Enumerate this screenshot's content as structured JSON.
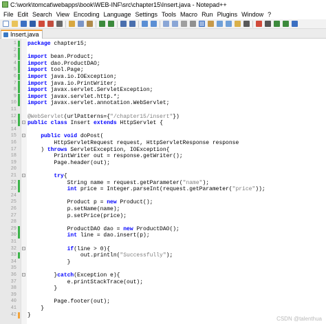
{
  "window": {
    "title": "C:\\work\\tomcat\\webapps\\book\\WEB-INF\\src\\chapter15\\Insert.java - Notepad++"
  },
  "menu": [
    "File",
    "Edit",
    "Search",
    "View",
    "Encoding",
    "Language",
    "Settings",
    "Tools",
    "Macro",
    "Run",
    "Plugins",
    "Window",
    "?"
  ],
  "tab": {
    "label": "Insert.java"
  },
  "colors": {
    "keyword": "#0000ff",
    "string": "#808080",
    "comment": "#008000",
    "change_saved": "#3cb34a",
    "change_unsaved": "#f2a33a"
  },
  "editor": {
    "lines": [
      {
        "n": "1",
        "text": "package chapter15;",
        "mark": "green"
      },
      {
        "n": "2",
        "text": "",
        "mark": "green"
      },
      {
        "n": "3",
        "text": "import bean.Product;",
        "mark": "green"
      },
      {
        "n": "4",
        "text": "import dao.ProductDAO;",
        "mark": "green"
      },
      {
        "n": "5",
        "text": "import tool.Page;",
        "mark": "green"
      },
      {
        "n": "6",
        "text": "import java.io.IOException;",
        "mark": "green"
      },
      {
        "n": "7",
        "text": "import java.io.PrintWriter;",
        "mark": "green"
      },
      {
        "n": "8",
        "text": "import javax.servlet.ServletException;",
        "mark": "green"
      },
      {
        "n": "9",
        "text": "import javax.servlet.http.*;",
        "mark": "green"
      },
      {
        "n": "10",
        "text": "import javax.servlet.annotation.WebServlet;",
        "mark": "green"
      },
      {
        "n": "11",
        "text": "",
        "mark": ""
      },
      {
        "n": "12",
        "text": "@WebServlet(urlPatterns={\"/chapter15/insert\"})",
        "mark": "green"
      },
      {
        "n": "13",
        "text": "public class Insert extends HttpServlet {",
        "mark": "green",
        "fold": true
      },
      {
        "n": "14",
        "text": "",
        "mark": ""
      },
      {
        "n": "15",
        "text": "    public void doPost(",
        "mark": "",
        "fold": true
      },
      {
        "n": "16",
        "text": "        HttpServletRequest request, HttpServletResponse response",
        "mark": ""
      },
      {
        "n": "17",
        "text": "    ) throws ServletException, IOException{",
        "mark": ""
      },
      {
        "n": "18",
        "text": "        PrintWriter out = response.getWriter();",
        "mark": ""
      },
      {
        "n": "19",
        "text": "        Page.header(out);",
        "mark": ""
      },
      {
        "n": "20",
        "text": "",
        "mark": ""
      },
      {
        "n": "21",
        "text": "        try{",
        "mark": "",
        "fold": true
      },
      {
        "n": "22",
        "text": "            String name = request.getParameter(\"name\");",
        "mark": "green"
      },
      {
        "n": "23",
        "text": "            int price = Integer.parseInt(request.getParameter(\"price\"));",
        "mark": "green"
      },
      {
        "n": "24",
        "text": "",
        "mark": ""
      },
      {
        "n": "25",
        "text": "            Product p = new Product();",
        "mark": ""
      },
      {
        "n": "26",
        "text": "            p.setName(name);",
        "mark": ""
      },
      {
        "n": "27",
        "text": "            p.setPrice(price);",
        "mark": ""
      },
      {
        "n": "28",
        "text": "",
        "mark": ""
      },
      {
        "n": "29",
        "text": "            ProductDAO dao = new ProductDAO();",
        "mark": "green"
      },
      {
        "n": "30",
        "text": "            int line = dao.insert(p);",
        "mark": "green"
      },
      {
        "n": "31",
        "text": "",
        "mark": ""
      },
      {
        "n": "32",
        "text": "            if(line > 0){",
        "mark": "",
        "fold": true
      },
      {
        "n": "33",
        "text": "                out.println(\"Successfully\");",
        "mark": "green"
      },
      {
        "n": "34",
        "text": "            }",
        "mark": ""
      },
      {
        "n": "35",
        "text": "",
        "mark": ""
      },
      {
        "n": "36",
        "text": "        }catch(Exception e){",
        "mark": "",
        "fold": true
      },
      {
        "n": "37",
        "text": "            e.printStackTrace(out);",
        "mark": ""
      },
      {
        "n": "38",
        "text": "        }",
        "mark": ""
      },
      {
        "n": "39",
        "text": "",
        "mark": ""
      },
      {
        "n": "40",
        "text": "        Page.footer(out);",
        "mark": ""
      },
      {
        "n": "41",
        "text": "    }",
        "mark": ""
      },
      {
        "n": "42",
        "text": "}",
        "mark": "orange"
      }
    ]
  },
  "watermark": "CSDN @talenthua"
}
